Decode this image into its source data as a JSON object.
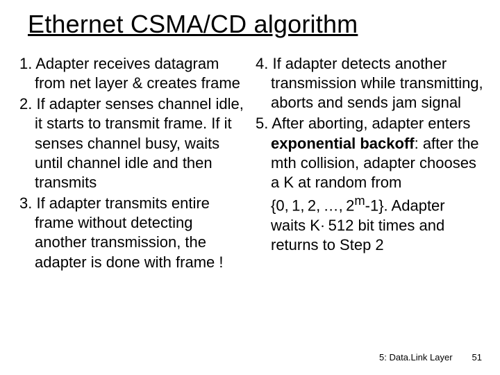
{
  "title": "Ethernet CSMA/CD algorithm",
  "left": {
    "p1": "1. Adapter receives datagram from net layer & creates frame",
    "p2": "2. If adapter senses channel idle, it starts to transmit frame. If it senses channel busy, waits until channel idle and then transmits",
    "p3": "3. If adapter transmits entire frame without detecting another transmission, the adapter is done with frame !"
  },
  "right": {
    "p1": "4. If adapter detects another transmission while transmitting,  aborts and sends jam signal",
    "p2a": "5. After aborting, adapter enters ",
    "p2b": "exponential backoff",
    "p2c": ": after the mth collision, adapter chooses a K at random from {0, 1, 2, …, 2",
    "p2d": "m",
    "p2e": "-1}. Adapter waits K· 512 bit times and returns to Step 2"
  },
  "footer": {
    "label": "5: Data.Link Layer",
    "page": "51"
  }
}
